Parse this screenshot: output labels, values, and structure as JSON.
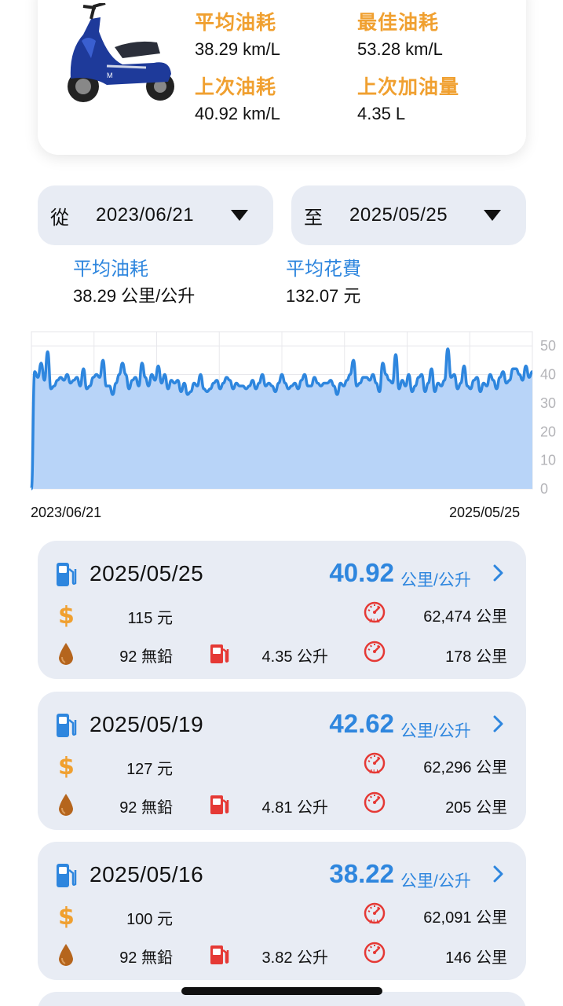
{
  "summary": {
    "avg_label": "平均油耗",
    "avg_value": "38.29 km/L",
    "best_label": "最佳油耗",
    "best_value": "53.28 km/L",
    "last_label": "上次油耗",
    "last_value": "40.92 km/L",
    "last_fill_label": "上次加油量",
    "last_fill_value": "4.35 L"
  },
  "range": {
    "from_prefix": "從",
    "from_date": "2023/06/21",
    "to_prefix": "至",
    "to_date": "2025/05/25"
  },
  "period": {
    "avg_eff_label": "平均油耗",
    "avg_eff_value": "38.29 公里/公升",
    "avg_cost_label": "平均花費",
    "avg_cost_value": "132.07 元"
  },
  "chart_data": {
    "type": "area",
    "title": "",
    "xlabel": "",
    "ylabel": "",
    "ylim": [
      0,
      55
    ],
    "y_ticks": [
      "50",
      "40",
      "30",
      "20",
      "10",
      "0"
    ],
    "x_start_label": "2023/06/21",
    "x_end_label": "2025/05/25",
    "grid": true,
    "values": [
      0,
      41,
      39,
      44,
      38,
      48,
      35,
      36,
      38,
      39,
      38,
      40,
      37,
      38,
      39,
      36,
      42,
      35,
      36,
      39,
      40,
      39,
      45,
      36,
      36,
      33,
      37,
      40,
      44,
      40,
      35,
      38,
      39,
      36,
      44,
      39,
      36,
      40,
      38,
      43,
      37,
      40,
      35,
      38,
      37,
      38,
      34,
      37,
      33,
      34,
      37,
      36,
      40,
      35,
      34,
      35,
      37,
      38,
      35,
      37,
      39,
      38,
      35,
      37,
      36,
      36,
      35,
      36,
      38,
      35,
      37,
      40,
      36,
      37,
      36,
      34,
      37,
      40,
      37,
      35,
      36,
      37,
      35,
      38,
      40,
      36,
      36,
      39,
      37,
      36,
      37,
      37,
      38,
      36,
      33,
      37,
      36,
      38,
      40,
      45,
      36,
      37,
      39,
      39,
      38,
      40,
      37,
      34,
      44,
      40,
      38,
      37,
      47,
      35,
      38,
      36,
      40,
      34,
      36,
      39,
      40,
      34,
      37,
      42,
      34,
      37,
      36,
      38,
      49,
      39,
      40,
      35,
      37,
      43,
      36,
      35,
      38,
      39,
      34,
      37,
      36,
      40,
      38,
      35,
      39,
      41,
      37,
      38,
      42,
      42,
      40,
      38,
      43,
      39,
      41
    ],
    "series_color": "#2e86de",
    "fill_color": "#b8d4f8"
  },
  "records": [
    {
      "date": "2025/05/25",
      "eff": "40.92",
      "eff_unit": "公里/公升",
      "price": "115 元",
      "odo": "62,474 公里",
      "grade": "92 無鉛",
      "vol": "4.35 公升",
      "dist": "178 公里"
    },
    {
      "date": "2025/05/19",
      "eff": "42.62",
      "eff_unit": "公里/公升",
      "price": "127 元",
      "odo": "62,296 公里",
      "grade": "92 無鉛",
      "vol": "4.81 公升",
      "dist": "205 公里"
    },
    {
      "date": "2025/05/16",
      "eff": "38.22",
      "eff_unit": "公里/公升",
      "price": "100 元",
      "odo": "62,091 公里",
      "grade": "92 無鉛",
      "vol": "3.82 公升",
      "dist": "146 公里"
    }
  ],
  "icons": {
    "pump": "fuel-pump-icon",
    "dollar": "dollar-icon",
    "odometer": "odometer-all-icon",
    "drop": "oil-drop-icon",
    "can": "fuel-can-icon",
    "trip": "trip-gauge-icon",
    "chevron": "chevron-right-icon"
  },
  "gauge_all_label": "ALL"
}
